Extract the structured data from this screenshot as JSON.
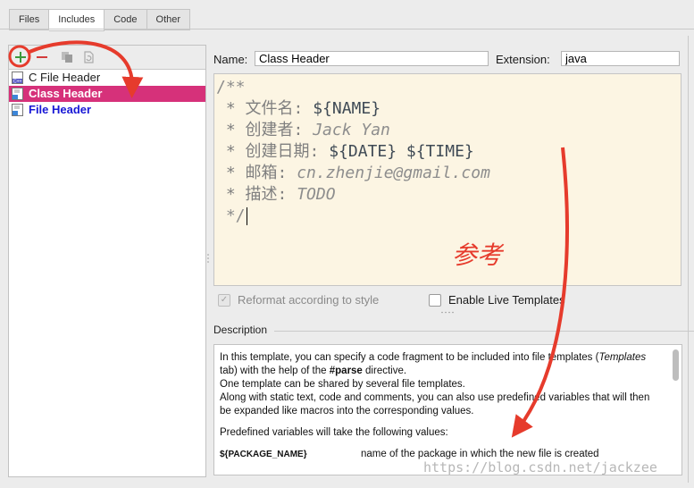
{
  "tabs": [
    {
      "label": "Files",
      "active": false
    },
    {
      "label": "Includes",
      "active": true
    },
    {
      "label": "Code",
      "active": false
    },
    {
      "label": "Other",
      "active": false
    }
  ],
  "toolbar": {
    "add_icon": "plus-icon",
    "remove_icon": "minus-icon",
    "copy_icon": "copy-icon",
    "reset_icon": "reset-icon"
  },
  "templates": [
    {
      "label": "C File Header",
      "icon": "c-file-icon",
      "state": "normal"
    },
    {
      "label": "Class Header",
      "icon": "java-file-icon",
      "state": "selected"
    },
    {
      "label": "File Header",
      "icon": "java-file-icon",
      "state": "modified"
    }
  ],
  "name_label": "Name:",
  "name_value": "Class Header",
  "extension_label": "Extension:",
  "extension_value": "java",
  "code": {
    "l1": "/**",
    "l2_prefix": " * 文件名: ",
    "l2_var": "${NAME}",
    "l3_prefix": " * 创建者: ",
    "l3_val": "Jack Yan",
    "l4_prefix": " * 创建日期: ",
    "l4_var": "${DATE} ${TIME}",
    "l5_prefix": " * 邮箱: ",
    "l5_val": "cn.zhenjie@gmail.com",
    "l6_prefix": " * 描述: ",
    "l6_val": "TODO",
    "l7": " */"
  },
  "annotation": "参考",
  "reformat_label": "Reformat according to style",
  "live_templates_label": "Enable Live Templates",
  "description": {
    "title": "Description",
    "p1_a": "In this template, you can specify a code fragment to be included into file templates (",
    "p1_b": "Templates",
    "p1_c": " tab) with the help of the ",
    "p1_d": "#parse",
    "p1_e": " directive.",
    "p2": "One template can be shared by several file templates.",
    "p3": "Along with static text, code and comments, you can also use predefined variables that will then be expanded like macros into the corresponding values.",
    "p4": "Predefined variables will take the following values:",
    "var_name": "${PACKAGE_NAME}",
    "var_desc": "name of the package in which the new file is created"
  },
  "watermark": "https://blog.csdn.net/jackzee",
  "colors": {
    "selection": "#d6317a",
    "annotation": "#e63b2c",
    "editor_bg": "#fcf5e3",
    "modified_text": "#1818d6"
  }
}
